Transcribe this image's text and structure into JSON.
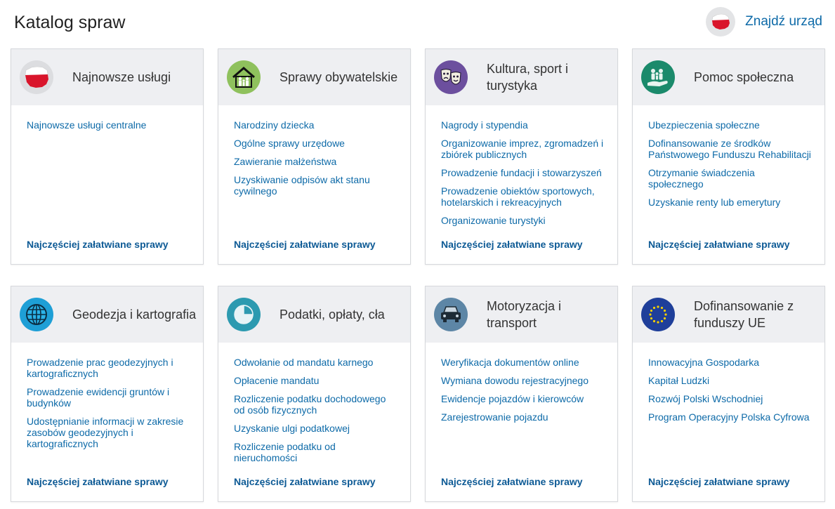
{
  "header": {
    "title": "Katalog spraw",
    "find_office_label": "Znajdź urząd",
    "find_office_icon": "poland-map-icon"
  },
  "colors": {
    "link": "#0d6aa8",
    "card_header_bg": "#eeeff2"
  },
  "cards": [
    {
      "title": "Najnowsze usługi",
      "icon": "poland-map-icon",
      "links": [
        "Najnowsze usługi centralne"
      ],
      "footer": "Najczęściej załatwiane sprawy"
    },
    {
      "title": "Sprawy obywatelskie",
      "icon": "family-house-icon",
      "links": [
        "Narodziny dziecka",
        "Ogólne sprawy urzędowe",
        "Zawieranie małżeństwa",
        "Uzyskiwanie odpisów akt stanu cywilnego"
      ],
      "footer": "Najczęściej załatwiane sprawy"
    },
    {
      "title": "Kultura, sport i turystyka",
      "icon": "theatre-masks-icon",
      "links": [
        "Nagrody i stypendia",
        "Organizowanie imprez, zgromadzeń i zbiórek publicznych",
        "Prowadzenie fundacji i stowarzyszeń",
        "Prowadzenie obiektów sportowych, hotelarskich i rekreacyjnych",
        "Organizowanie turystyki"
      ],
      "footer": "Najczęściej załatwiane sprawy"
    },
    {
      "title": "Pomoc społeczna",
      "icon": "helping-hand-icon",
      "links": [
        "Ubezpieczenia społeczne",
        "Dofinansowanie ze środków Państwowego Funduszu Rehabilitacji",
        "Otrzymanie świadczenia społecznego",
        "Uzyskanie renty lub emerytury"
      ],
      "footer": "Najczęściej załatwiane sprawy"
    },
    {
      "title": "Geodezja i kartografia",
      "icon": "globe-icon",
      "links": [
        "Prowadzenie prac geodezyjnych i kartograficznych",
        "Prowadzenie ewidencji gruntów i budynków",
        "Udostępnianie informacji w zakresie zasobów geodezyjnych i kartograficznych"
      ],
      "footer": "Najczęściej załatwiane sprawy"
    },
    {
      "title": "Podatki, opłaty, cła",
      "icon": "pie-chart-icon",
      "links": [
        "Odwołanie od mandatu karnego",
        "Opłacenie mandatu",
        "Rozliczenie podatku dochodowego od osób fizycznych",
        "Uzyskanie ulgi podatkowej",
        "Rozliczenie podatku od nieruchomości"
      ],
      "footer": "Najczęściej załatwiane sprawy"
    },
    {
      "title": "Motoryzacja i transport",
      "icon": "car-icon",
      "links": [
        "Weryfikacja dokumentów online",
        "Wymiana dowodu rejestracyjnego",
        "Ewidencje pojazdów i kierowców",
        "Zarejestrowanie pojazdu"
      ],
      "footer": "Najczęściej załatwiane sprawy"
    },
    {
      "title": "Dofinansowanie z funduszy UE",
      "icon": "eu-flag-icon",
      "links": [
        "Innowacyjna Gospodarka",
        "Kapitał Ludzki",
        "Rozwój Polski Wschodniej",
        "Program Operacyjny Polska Cyfrowa"
      ],
      "footer": "Najczęściej załatwiane sprawy"
    }
  ]
}
